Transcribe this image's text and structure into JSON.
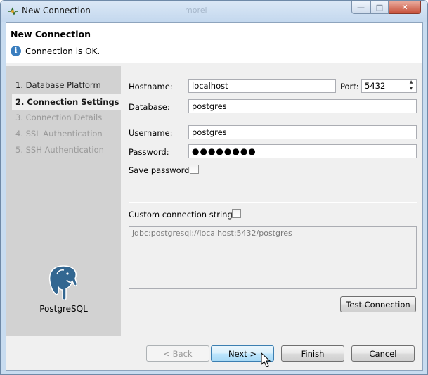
{
  "window": {
    "title": "New Connection",
    "background_title": "morel",
    "controls": {
      "minimize": "—",
      "maximize": "□",
      "close": "✕"
    }
  },
  "header": {
    "title": "New Connection",
    "message": "Connection is OK.",
    "message_icon": "info-icon"
  },
  "nav": {
    "items": [
      {
        "label": "1. Database Platform",
        "state": "normal"
      },
      {
        "label": "2. Connection Settings",
        "state": "active"
      },
      {
        "label": "3. Connection Details",
        "state": "disabled"
      },
      {
        "label": "4. SSL Authentication",
        "state": "disabled"
      },
      {
        "label": "5. SSH Authentication",
        "state": "disabled"
      }
    ],
    "platform_label": "PostgreSQL",
    "platform_icon": "postgresql-elephant-icon"
  },
  "form": {
    "hostname_label": "Hostname:",
    "hostname_value": "localhost",
    "port_label": "Port:",
    "port_value": "5432",
    "database_label": "Database:",
    "database_value": "postgres",
    "username_label": "Username:",
    "username_value": "postgres",
    "password_label": "Password:",
    "password_value": "●●●●●●●●",
    "save_password_label": "Save password:",
    "save_password_checked": false,
    "custom_string_label": "Custom connection string:",
    "custom_string_checked": false,
    "connection_string": "jdbc:postgresql://localhost:5432/postgres",
    "test_button": "Test Connection"
  },
  "footer": {
    "back": "< Back",
    "next": "Next >",
    "finish": "Finish",
    "cancel": "Cancel"
  },
  "colors": {
    "frame_blue": "#c8dcf0",
    "nav_gray": "#d2d2d2",
    "info_blue": "#3a7ebf",
    "focus_button": "#a7d9f5"
  }
}
